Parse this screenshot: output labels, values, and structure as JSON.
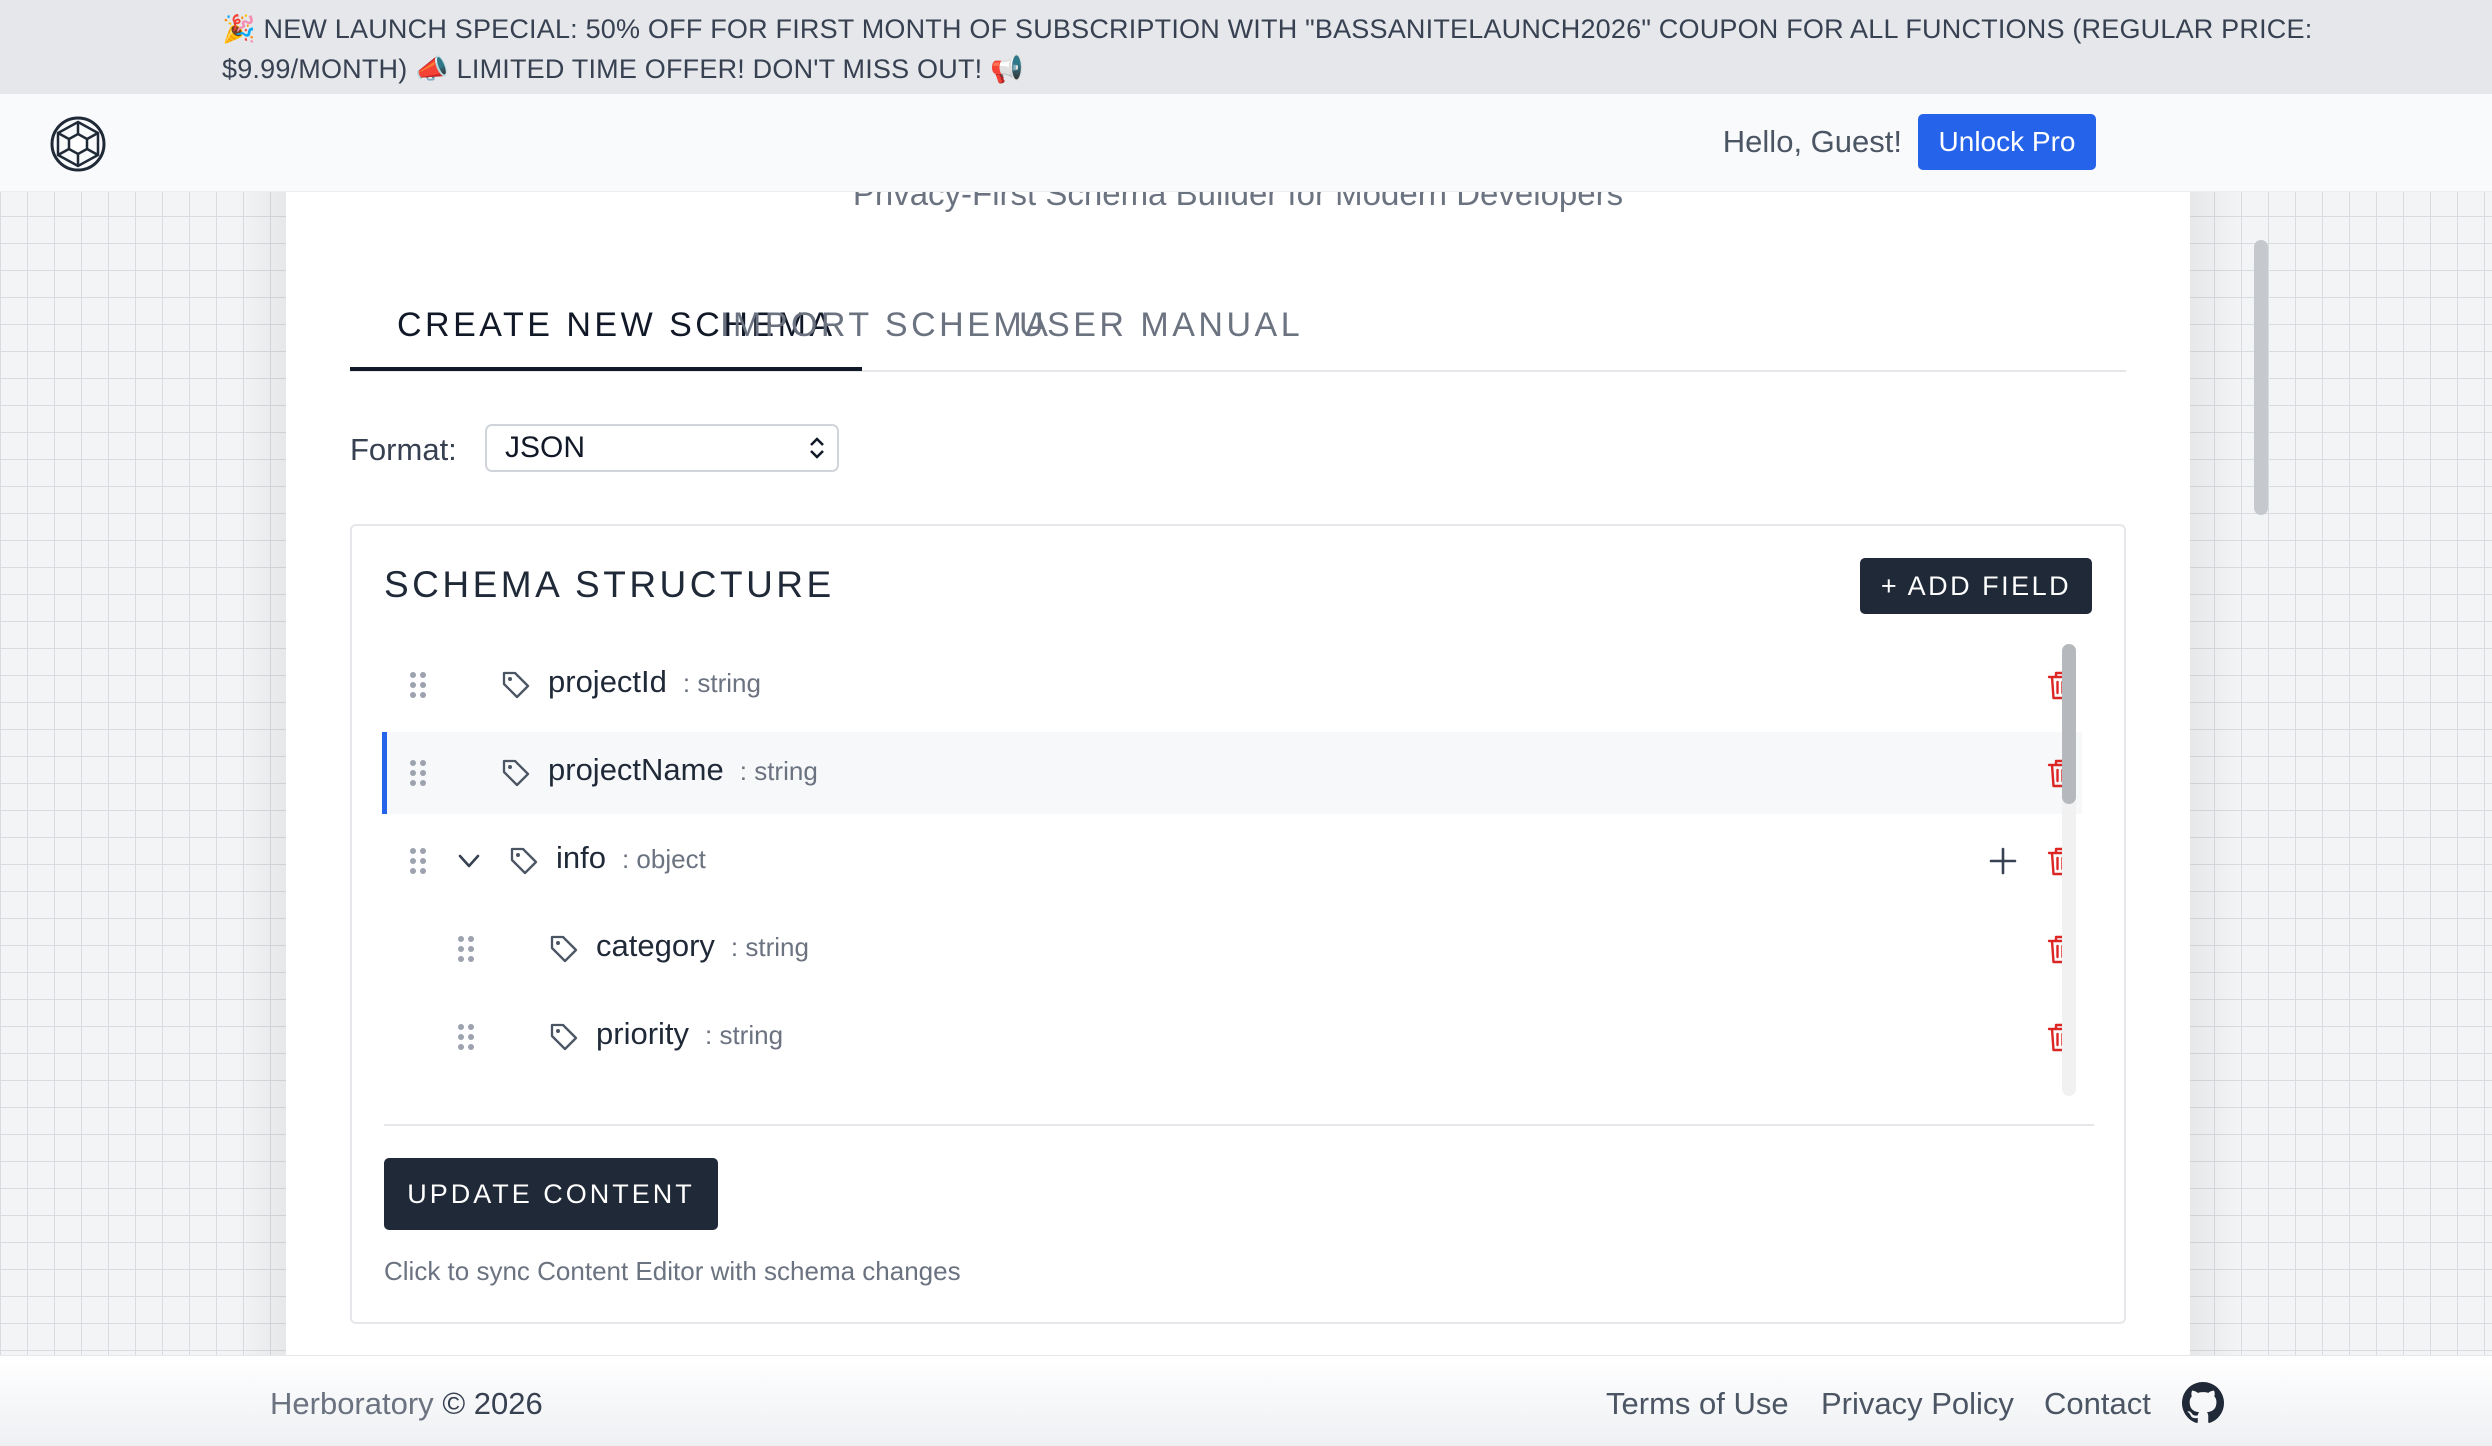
{
  "promo": {
    "text": "🎉 NEW LAUNCH SPECIAL: 50% OFF FOR FIRST MONTH OF SUBSCRIPTION WITH \"BASSANITELAUNCH2026\" COUPON FOR ALL FUNCTIONS   (REGULAR PRICE: $9.99/MONTH) 📣 LIMITED TIME OFFER! DON'T MISS OUT! 📢"
  },
  "header": {
    "logo_icon": "app-logo-icon",
    "greeting": "Hello, Guest!",
    "unlock_label": "Unlock Pro",
    "accent_color": "#2563eb"
  },
  "main": {
    "subtitle": "Privacy-First Schema Builder for Modern Developers",
    "tabs": [
      {
        "label": "CREATE NEW SCHEMA",
        "active": true
      },
      {
        "label": "IMPORT SCHEMA",
        "active": false
      },
      {
        "label": "USER MANUAL",
        "active": false
      }
    ],
    "format": {
      "label": "Format:",
      "selected": "JSON"
    },
    "schema": {
      "title": "SCHEMA STRUCTURE",
      "add_field_label": "+ ADD FIELD",
      "fields": [
        {
          "name": "projectId",
          "type": ": string",
          "depth": 0,
          "selected": false,
          "expandable": false
        },
        {
          "name": "projectName",
          "type": ": string",
          "depth": 0,
          "selected": true,
          "expandable": false
        },
        {
          "name": "info",
          "type": ": object",
          "depth": 0,
          "selected": false,
          "expandable": true,
          "expanded": true
        },
        {
          "name": "category",
          "type": ": string",
          "depth": 1,
          "selected": false,
          "expandable": false
        },
        {
          "name": "priority",
          "type": ": string",
          "depth": 1,
          "selected": false,
          "expandable": false
        }
      ],
      "update_label": "UPDATE CONTENT",
      "hint": "Click to sync Content Editor with schema changes",
      "delete_color": "#dc2626"
    }
  },
  "footer": {
    "brand": "Herboratory",
    "copyright": "© 2026",
    "links": [
      "Terms of Use",
      "Privacy Policy",
      "Contact"
    ],
    "github_icon": "github-icon"
  }
}
